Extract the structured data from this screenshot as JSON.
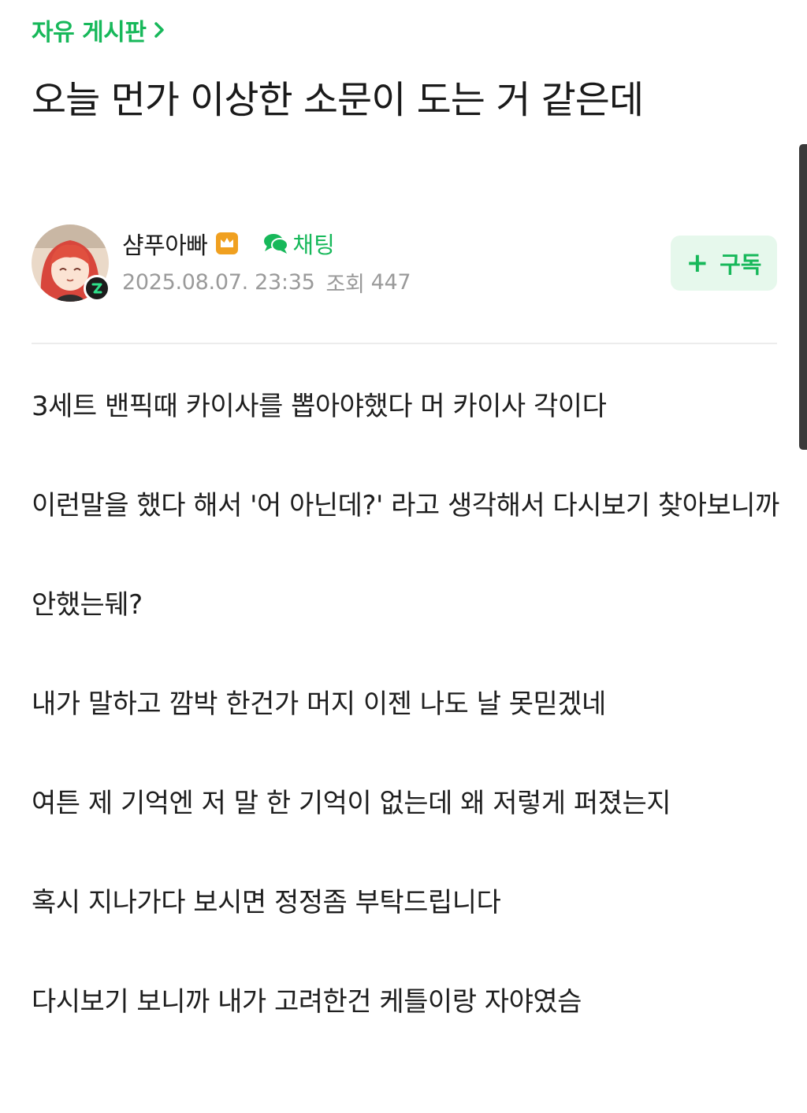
{
  "board": {
    "name": "자유 게시판"
  },
  "post": {
    "title": "오늘 먼가 이상한 소문이 도는 거 같은데",
    "author": {
      "nickname": "샴푸아빠",
      "chat_label": "채팅"
    },
    "meta": {
      "datetime": "2025.08.07. 23:35",
      "views_label": "조회",
      "views_value": "447"
    },
    "subscribe_label": "구독",
    "paragraphs": [
      "3세트 밴픽때 카이사를 뽑아야했다 머 카이사 각이다",
      "이런말을 했다 해서 '어 아닌데?' 라고 생각해서 다시보기 찾아보니까",
      "안했는뒈?",
      "내가 말하고 깜박 한건가 머지 이젠 나도 날 못믿겠네",
      "여튼 제 기억엔 저 말 한 기억이 없는데 왜 저렇게 퍼졌는지",
      "혹시 지나가다 보시면 정정좀 부탁드립니다",
      "다시보기 보니까 내가 고려한건 케틀이랑 자야였슴"
    ]
  },
  "colors": {
    "accent": "#17b85a",
    "accent_bg": "#e6f8ec",
    "meta_text": "#9a9a9a",
    "crown_badge": "#f0a020"
  },
  "icons": {
    "board_chevron": "chevron-right-icon",
    "crown": "crown-icon",
    "chat": "chat-bubble-icon",
    "level": "level-badge-icon"
  }
}
